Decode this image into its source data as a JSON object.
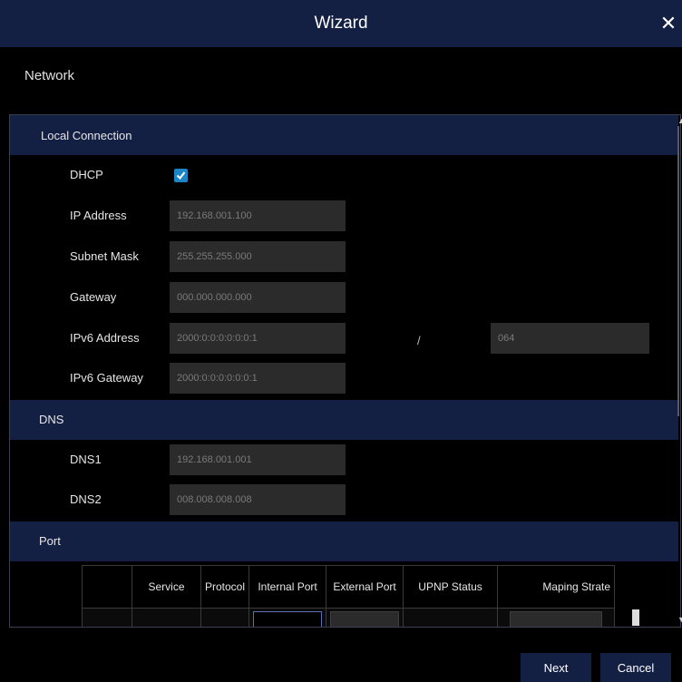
{
  "window": {
    "title": "Wizard",
    "close_glyph": "✕"
  },
  "section": {
    "name": "Network"
  },
  "local": {
    "header": "Local Connection",
    "dhcp_label": "DHCP",
    "dhcp_checked": true,
    "ip_label": "IP Address",
    "ip_value": "192.168.001.100",
    "subnet_label": "Subnet Mask",
    "subnet_value": "255.255.255.000",
    "gateway_label": "Gateway",
    "gateway_value": "000.000.000.000",
    "ipv6_label": "IPv6 Address",
    "ipv6_value": "2000:0:0:0:0:0:0:1",
    "ipv6_sep": "/",
    "ipv6_prefix": "064",
    "ipv6_gw_label": "IPv6 Gateway",
    "ipv6_gw_value": "2000:0:0:0:0:0:0:1"
  },
  "dns": {
    "header": "DNS",
    "dns1_label": "DNS1",
    "dns1_value": "192.168.001.001",
    "dns2_label": "DNS2",
    "dns2_value": "008.008.008.008"
  },
  "port": {
    "header": "Port",
    "columns": [
      "",
      "Service",
      "Protocol",
      "Internal Port",
      "External Port",
      "UPNP Status",
      "Maping Strate"
    ]
  },
  "footer": {
    "next_label": "Next",
    "cancel_label": "Cancel"
  },
  "colors": {
    "header_bg": "#142043",
    "field_bg": "#2b2b2b",
    "checkbox": "#1d86c6"
  }
}
